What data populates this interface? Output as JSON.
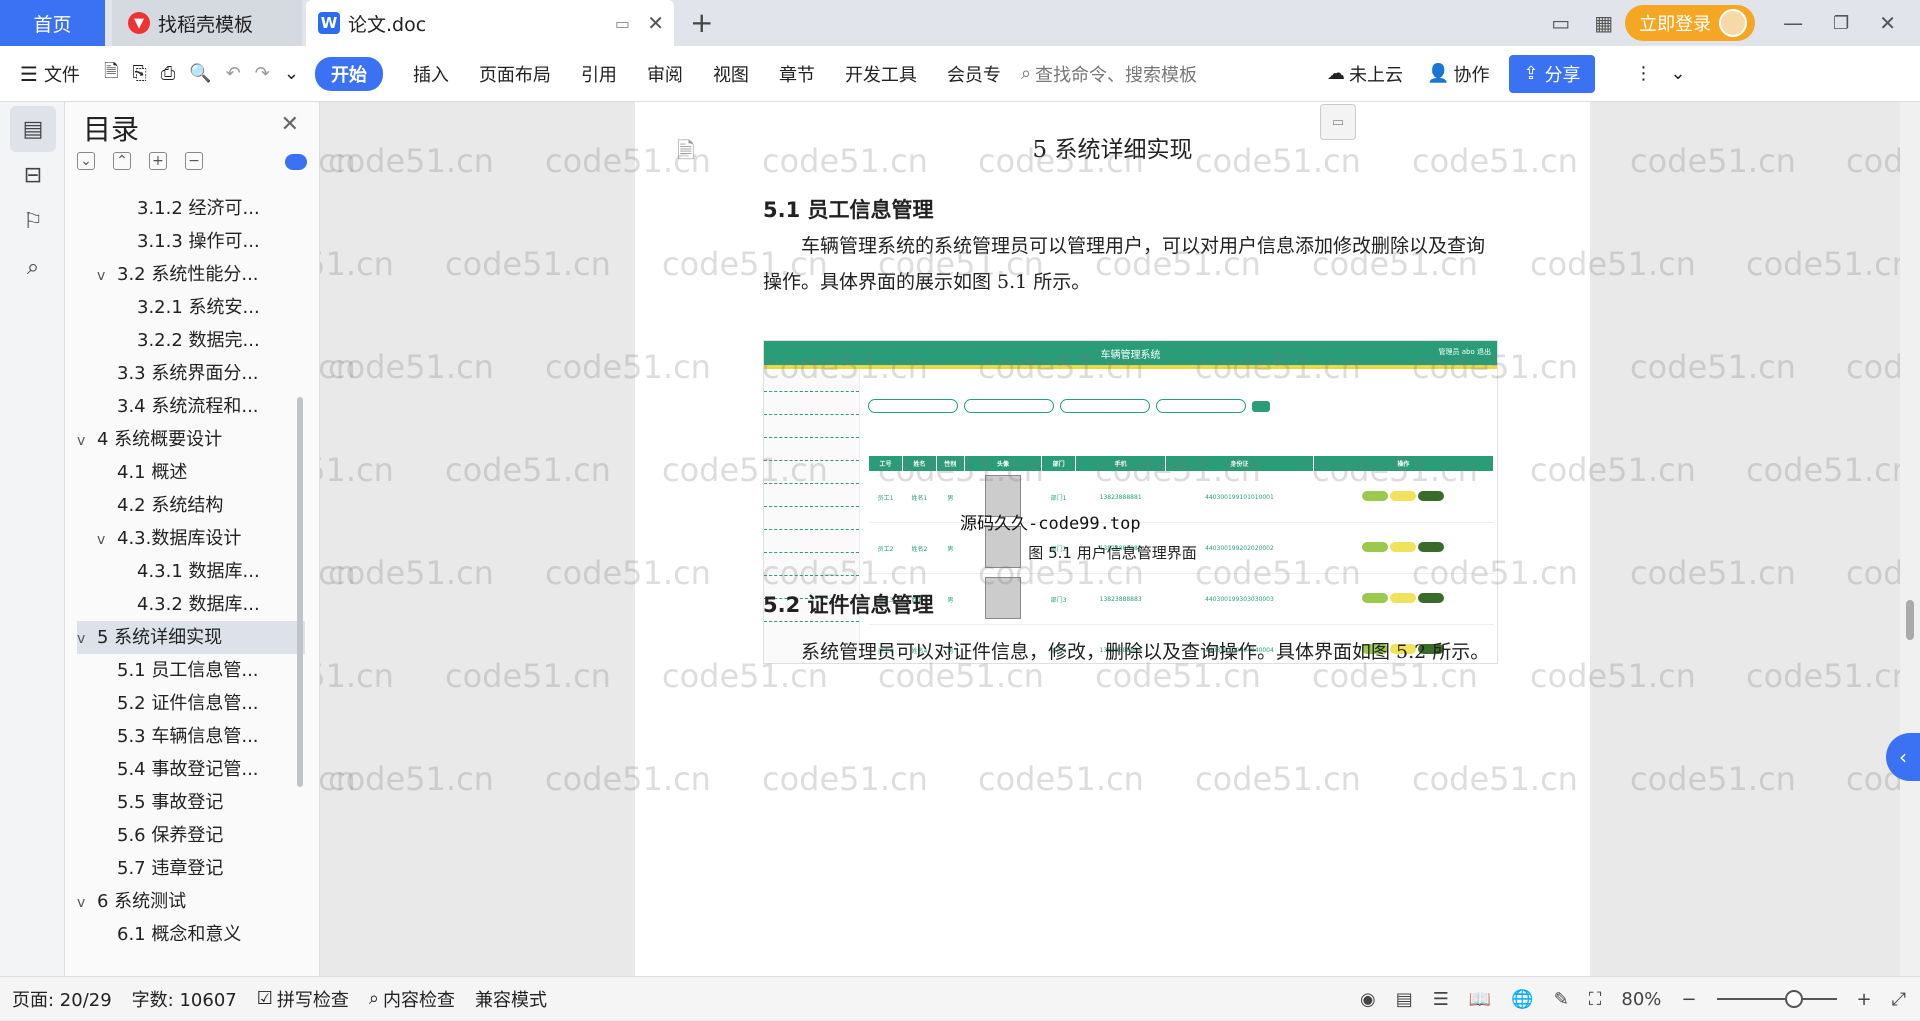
{
  "tabs": {
    "home": "首页",
    "template": "找稻壳模板",
    "document": "论文.doc",
    "new_tab": "+"
  },
  "account": {
    "login": "立即登录"
  },
  "toolbar": {
    "file": "文件",
    "items": [
      "开始",
      "插入",
      "页面布局",
      "引用",
      "审阅",
      "视图",
      "章节",
      "开发工具",
      "会员专"
    ],
    "search_placeholder": "查找命令、搜索模板",
    "cloud": "未上云",
    "collab": "协作",
    "share": "分享"
  },
  "toc": {
    "title": "目录",
    "items": [
      {
        "label": "3.1.2 经济可...",
        "level": 3,
        "caret": ""
      },
      {
        "label": "3.1.3 操作可...",
        "level": 3,
        "caret": ""
      },
      {
        "label": "3.2 系统性能分...",
        "level": 2,
        "caret": "v"
      },
      {
        "label": "3.2.1  系统安...",
        "level": 3,
        "caret": ""
      },
      {
        "label": "3.2.2  数据完...",
        "level": 3,
        "caret": ""
      },
      {
        "label": "3.3 系统界面分...",
        "level": 2,
        "caret": ""
      },
      {
        "label": "3.4 系统流程和...",
        "level": 2,
        "caret": ""
      },
      {
        "label": "4 系统概要设计",
        "level": 1,
        "caret": "v"
      },
      {
        "label": "4.1 概述",
        "level": 2,
        "caret": ""
      },
      {
        "label": "4.2 系统结构",
        "level": 2,
        "caret": ""
      },
      {
        "label": "4.3.数据库设计",
        "level": 2,
        "caret": "v"
      },
      {
        "label": "4.3.1 数据库...",
        "level": 3,
        "caret": ""
      },
      {
        "label": "4.3.2 数据库...",
        "level": 3,
        "caret": ""
      },
      {
        "label": "5 系统详细实现",
        "level": 1,
        "caret": "v",
        "selected": true
      },
      {
        "label": "5.1  员工信息管...",
        "level": 2,
        "caret": ""
      },
      {
        "label": "5.2  证件信息管...",
        "level": 2,
        "caret": ""
      },
      {
        "label": "5.3  车辆信息管...",
        "level": 2,
        "caret": ""
      },
      {
        "label": "5.4  事故登记管...",
        "level": 2,
        "caret": ""
      },
      {
        "label": "5.5  事故登记",
        "level": 2,
        "caret": ""
      },
      {
        "label": "5.6  保养登记",
        "level": 2,
        "caret": ""
      },
      {
        "label": "5.7  违章登记",
        "level": 2,
        "caret": ""
      },
      {
        "label": "6 系统测试",
        "level": 1,
        "caret": "v"
      },
      {
        "label": "6.1 概念和意义",
        "level": 2,
        "caret": ""
      }
    ]
  },
  "doc": {
    "heading1": "5 系统详细实现",
    "h2_1": "5.1  员工信息管理",
    "para1": "车辆管理系统的系统管理员可以管理用户，可以对用户信息添加修改删除以及查询操作。具体界面的展示如图 5.1 所示。",
    "fig_caption": "图 5.1  用户信息管理界面",
    "overlay": "源码久久-code99.top",
    "h2_2": "5.2  证件信息管理",
    "para2": "系统管理员可以对证件信息，修改，删除以及查询操作。具体界面如图 5.2 所示。",
    "screenshot": {
      "title": "车辆管理系统",
      "user": "管理员 abo   退出",
      "table_headers": [
        "工号",
        "姓名",
        "性别",
        "头像",
        "部门",
        "手机",
        "身份证",
        "操作"
      ],
      "rows": [
        [
          "员工1",
          "姓名1",
          "男",
          "",
          "部门1",
          "13823888881",
          "440300199101010001"
        ],
        [
          "员工2",
          "姓名2",
          "男",
          "",
          "部门2",
          "13823888882",
          "440300199202020002"
        ],
        [
          "员工3",
          "姓名3",
          "男",
          "",
          "部门3",
          "13823888883",
          "440300199303030003"
        ],
        [
          "员工4",
          "姓名4",
          "男",
          "",
          "部门4",
          "13823888884",
          "440300199404040004"
        ]
      ]
    }
  },
  "watermark": "code51.cn",
  "status": {
    "page": "页面: 20/29",
    "words": "字数: 10607",
    "spell": "拼写检查",
    "content": "内容检查",
    "compat": "兼容模式",
    "zoom": "80%"
  },
  "colors": {
    "accent": "#3a72f3",
    "login": "#f5a623",
    "table_green": "#2a9d78"
  }
}
